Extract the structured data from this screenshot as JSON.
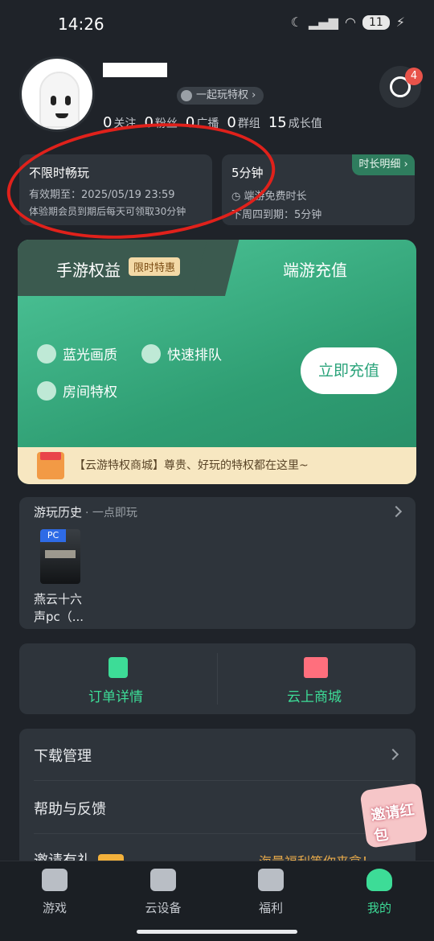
{
  "status_bar": {
    "time": "14:26",
    "battery": "11"
  },
  "profile": {
    "privilege_tag": "一起玩特权",
    "stats": [
      {
        "value": "0",
        "label": "关注"
      },
      {
        "value": "0",
        "label": "粉丝"
      },
      {
        "value": "0",
        "label": "广播"
      },
      {
        "value": "0",
        "label": "群组"
      },
      {
        "value": "15",
        "label": "成长值"
      }
    ],
    "message_badge": "4"
  },
  "time_cards": {
    "left": {
      "title": "不限时畅玩",
      "expiry": "有效期至：2025/05/19 23:59",
      "note": "体验期会员到期后每天可领取30分钟"
    },
    "right": {
      "minutes": "5分钟",
      "link": "时长明细",
      "desc": "端游免费时长",
      "next": "下周四到期：5分钟"
    }
  },
  "privilege_panel": {
    "tab_left": "手游权益",
    "tab_left_tag": "限时特惠",
    "tab_right": "端游充值",
    "features": [
      "蓝光画质",
      "快速排队",
      "房间特权"
    ],
    "recharge_button": "立即充值",
    "banner": "【云游特权商城】尊贵、好玩的特权都在这里~"
  },
  "history": {
    "title": "游玩历史",
    "subtitle": "· 一点即玩",
    "games": [
      {
        "badge": "PC",
        "name": "燕云十六声pc（..."
      }
    ]
  },
  "shortcuts": {
    "order": "订单详情",
    "mall": "云上商城"
  },
  "settings_list": {
    "download": "下载管理",
    "help": "帮助与反馈",
    "invite": "邀请有礼",
    "invite_promo": "海量福利等你来拿！"
  },
  "floating": {
    "redpack_text": "邀请红包"
  },
  "bottom_nav": {
    "items": [
      {
        "label": "游戏",
        "icon": "gamepad-icon"
      },
      {
        "label": "云设备",
        "icon": "cloud-device-icon"
      },
      {
        "label": "福利",
        "icon": "gift-icon"
      },
      {
        "label": "我的",
        "icon": "user-icon"
      }
    ],
    "active": "我的"
  },
  "colors": {
    "accent": "#3ddc97",
    "background": "#1f2329",
    "card": "#2e343b",
    "annotation_red": "#e0211b"
  }
}
